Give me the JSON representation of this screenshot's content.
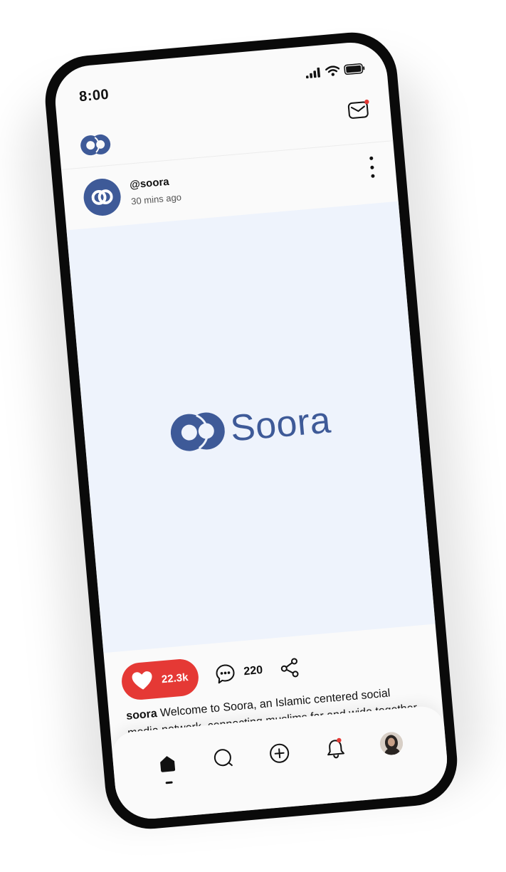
{
  "status_bar": {
    "time": "8:00"
  },
  "header": {
    "logo_icon": "soora-logo-icon",
    "mail_icon": "mail-icon",
    "notification_color": "#e53935"
  },
  "post": {
    "username": "@soora",
    "time_ago": "30 mins ago",
    "more_icon": "more-vertical-icon",
    "media_brand": "Soora",
    "likes": "22.3k",
    "comments": "220",
    "caption_user": "soora",
    "caption_text": " Welcome to Soora, an Islamic centered social media network, connecting muslims far and wide together."
  },
  "nav": {
    "items": [
      {
        "name": "home",
        "icon": "home-icon",
        "active": true
      },
      {
        "name": "search",
        "icon": "search-icon",
        "active": false
      },
      {
        "name": "create",
        "icon": "plus-circle-icon",
        "active": false
      },
      {
        "name": "notifications",
        "icon": "bell-icon",
        "active": false
      },
      {
        "name": "profile",
        "icon": "profile-avatar",
        "active": false
      }
    ]
  },
  "colors": {
    "brand": "#3e5a98",
    "like": "#e53935",
    "media_bg": "#eef3fc"
  }
}
